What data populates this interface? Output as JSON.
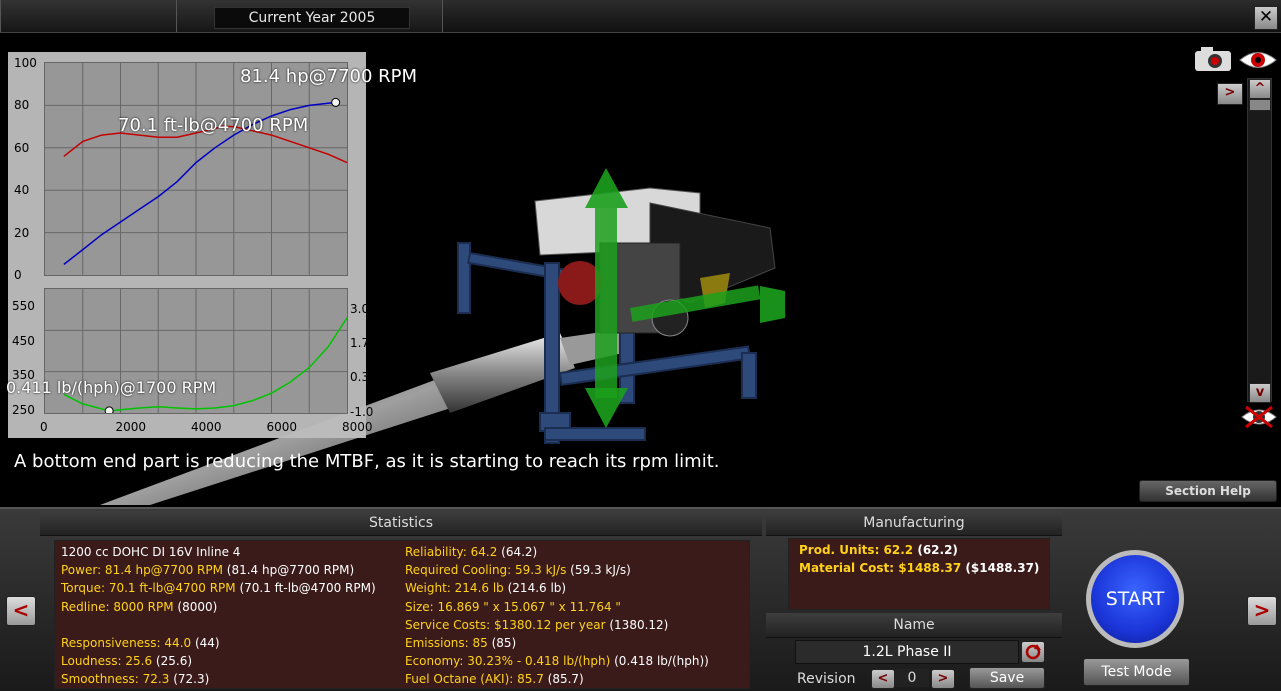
{
  "header": {
    "current_year": "Current Year 2005",
    "close_symbol": "✕"
  },
  "viewport": {
    "status_message": "A bottom end part is reducing the MTBF, as it is starting to reach its rpm limit.",
    "section_help": "Section Help"
  },
  "chart_data": [
    {
      "type": "line",
      "title": "",
      "ylim": [
        0,
        100
      ],
      "yticks": [
        "100",
        "80",
        "60",
        "40",
        "20",
        "0"
      ],
      "xlim": [
        0,
        8000
      ],
      "series": [
        {
          "name": "",
          "color": "#0000cc",
          "x": [
            500,
            1000,
            1500,
            2000,
            2500,
            3000,
            3500,
            4000,
            4500,
            5000,
            5500,
            6000,
            6500,
            7000,
            7500,
            7700
          ],
          "y": [
            5,
            12,
            19,
            25,
            31,
            37,
            44,
            53,
            60,
            66,
            71,
            75,
            78,
            80,
            81,
            81.4
          ]
        },
        {
          "name": "",
          "color": "#cc0000",
          "x": [
            500,
            1000,
            1500,
            2000,
            2500,
            3000,
            3500,
            4000,
            4500,
            4700,
            5000,
            5500,
            6000,
            6500,
            7000,
            7500,
            8000
          ],
          "y": [
            56,
            63,
            66,
            67,
            66,
            65,
            65,
            67,
            69,
            70.1,
            70,
            68,
            66,
            63,
            60,
            57,
            53
          ]
        }
      ],
      "annotations": [
        "81.4 hp@7700 RPM",
        "70.1 ft-lb@4700 RPM"
      ]
    },
    {
      "type": "line",
      "title": "",
      "xlim": [
        0,
        8000
      ],
      "ylim": [
        250,
        550
      ],
      "yticks_left": [
        "550",
        "450",
        "350",
        "250"
      ],
      "yticks_right": [
        "3.0",
        "1.7",
        "0.3",
        "-1.0"
      ],
      "xticks": [
        "0",
        "2000",
        "4000",
        "6000",
        "8000"
      ],
      "series": [
        {
          "name": "",
          "color": "#00cc00",
          "x": [
            500,
            1000,
            1500,
            1700,
            2000,
            2500,
            3000,
            3500,
            4000,
            4500,
            5000,
            5500,
            6000,
            6500,
            7000,
            7500,
            8000
          ],
          "y": [
            295,
            272,
            260,
            255,
            258,
            262,
            265,
            262,
            260,
            262,
            268,
            280,
            298,
            325,
            360,
            410,
            480
          ]
        }
      ],
      "annotations": [
        "0.411 lb/(hph)@1700 RPM"
      ]
    }
  ],
  "statistics": {
    "heading": "Statistics",
    "left": [
      {
        "label": "1200 cc DOHC DI 16V Inline 4",
        "value": "",
        "color": "white"
      },
      {
        "label": "Power: 81.4 hp@7700 RPM",
        "value": " (81.4 hp@7700 RPM)",
        "color": "yellow"
      },
      {
        "label": "Torque: 70.1 ft-lb@4700 RPM",
        "value": " (70.1 ft-lb@4700 RPM)",
        "color": "yellow"
      },
      {
        "label": "Redline: 8000 RPM",
        "value": " (8000)",
        "color": "yellow"
      },
      {
        "label": "",
        "value": "",
        "color": "yellow"
      },
      {
        "label": "Responsiveness: 44.0",
        "value": " (44)",
        "color": "yellow"
      },
      {
        "label": "Loudness: 25.6",
        "value": " (25.6)",
        "color": "yellow"
      },
      {
        "label": "Smoothness: 72.3",
        "value": " (72.3)",
        "color": "yellow"
      }
    ],
    "right": [
      {
        "label": "Reliability: 64.2",
        "value": " (64.2)"
      },
      {
        "label": "Required Cooling: 59.3 kJ/s",
        "value": " (59.3 kJ/s)"
      },
      {
        "label": "Weight: 214.6 lb",
        "value": " (214.6 lb)"
      },
      {
        "label": "Size: 16.869 \" x 15.067 \" x 11.764 \"",
        "value": ""
      },
      {
        "label": "Service Costs: $1380.12 per year",
        "value": " (1380.12)"
      },
      {
        "label": "Emissions: 85",
        "value": " (85)"
      },
      {
        "label": "Economy: 30.23% - 0.418 lb/(hph)",
        "value": " (0.418 lb/(hph))"
      },
      {
        "label": "Fuel Octane (AKI): 85.7",
        "value": " (85.7)"
      }
    ]
  },
  "manufacturing": {
    "heading": "Manufacturing",
    "prod_units_label": "Prod. Units: 62.2",
    "prod_units_value": " (62.2)",
    "material_cost_label": "Material Cost: $1488.37",
    "material_cost_value": " ($1488.37)"
  },
  "name_panel": {
    "heading": "Name",
    "name_value": "1.2L Phase II",
    "revision_label": "Revision",
    "revision_value": "0",
    "save_label": "Save"
  },
  "actions": {
    "start_label": "START",
    "test_mode_label": "Test Mode",
    "prev_symbol": "<",
    "next_symbol": ">"
  },
  "side_controls": {
    "expand_symbol": ">",
    "up_symbol": "^",
    "down_symbol": "v"
  },
  "colors": {
    "stats_bg": "#3b1a1a",
    "accent_yellow": "#ffd21a",
    "start_blue": "#1b35d8"
  }
}
